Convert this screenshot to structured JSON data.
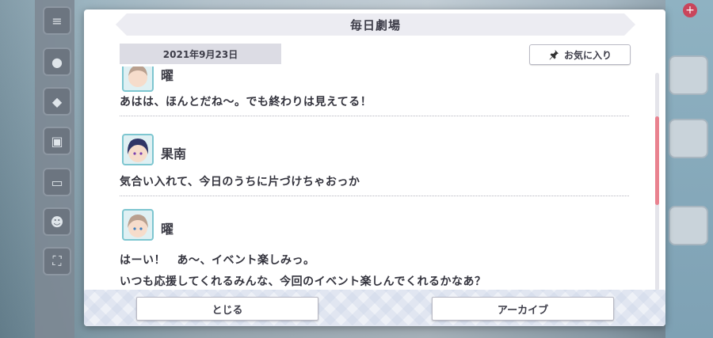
{
  "dialog": {
    "title": "毎日劇場",
    "date": "2021年9月23日",
    "favorite_label": "お気に入り"
  },
  "entries": [
    {
      "speaker": "曜",
      "lines": [
        "あはは、ほんとだね〜。でも終わりは見えてる！"
      ]
    },
    {
      "speaker": "果南",
      "lines": [
        "気合い入れて、今日のうちに片づけちゃおっか"
      ]
    },
    {
      "speaker": "曜",
      "lines": [
        "はーい！　あ〜、イベント楽しみっ。",
        "いつも応援してくれるみんな、今回のイベント楽しんでくれるかなあ？"
      ]
    }
  ],
  "footer": {
    "close_label": "とじる",
    "archive_label": "アーカイブ"
  },
  "colors": {
    "accent": "#e9828f",
    "avatar_border": "#7dc6d0",
    "title_bg": "#ececf2"
  }
}
